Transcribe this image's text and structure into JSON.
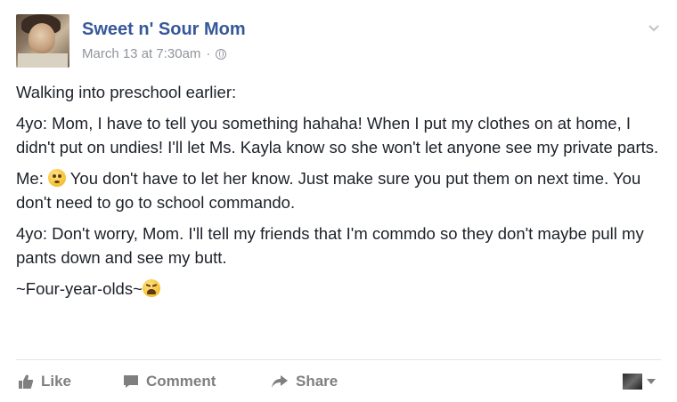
{
  "post": {
    "author": "Sweet n' Sour Mom",
    "timestamp": "March 13 at 7:30am",
    "separator": "·",
    "paragraphs": {
      "p1": "Walking into preschool earlier:",
      "p2": "4yo: Mom, I have to tell you something hahaha! When I put my clothes on at home, I didn't put on undies! I'll let Ms. Kayla know so she won't let anyone see my private parts.",
      "p3a": "Me: ",
      "p3b": " You don't have to let her know. Just make sure you put them on next time. You don't need to go to school commando.",
      "p4": "4yo: Don't worry, Mom. I'll tell my friends that I'm commdo so they don't maybe pull my pants down and see my butt.",
      "p5": "~Four-year-olds~"
    }
  },
  "actions": {
    "like": "Like",
    "comment": "Comment",
    "share": "Share"
  },
  "icons": {
    "audience": "globe-icon",
    "menu": "chevron-down-icon",
    "emoji1": "flushed-face-emoji",
    "emoji2": "weary-face-emoji"
  }
}
